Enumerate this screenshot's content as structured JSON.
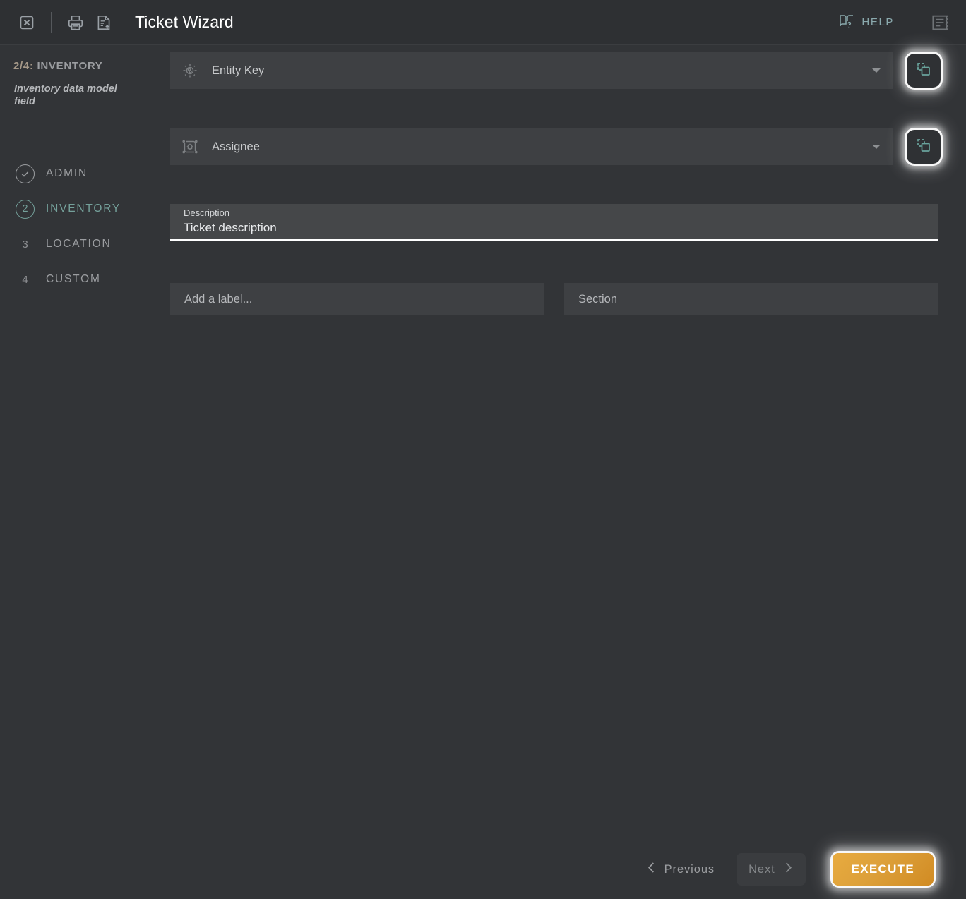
{
  "header": {
    "title": "Ticket Wizard",
    "close_icon": "close-box-icon",
    "print_icon": "printer-icon",
    "export_icon": "document-upload-icon",
    "help_label": "HELP",
    "help_icon": "book-question-icon",
    "log_icon": "log-receipt-icon"
  },
  "sidebar": {
    "step_fraction": "2/4:",
    "step_name": "INVENTORY",
    "step_description": "Inventory data model field",
    "steps": [
      {
        "marker": "✓",
        "label": "ADMIN",
        "state": "complete"
      },
      {
        "marker": "2",
        "label": "INVENTORY",
        "state": "active"
      },
      {
        "marker": "3",
        "label": "LOCATION",
        "state": "pending"
      },
      {
        "marker": "4",
        "label": "CUSTOM",
        "state": "pending"
      }
    ]
  },
  "main": {
    "entity_key": {
      "label": "Entity Key",
      "icon": "target-gear-icon",
      "copy_icon": "copy-duplicate-icon"
    },
    "assignee": {
      "label": "Assignee",
      "icon": "chip-gear-icon",
      "copy_icon": "copy-duplicate-icon"
    },
    "description": {
      "label": "Description",
      "value": "Ticket description"
    },
    "label_input": {
      "placeholder": "Add a label..."
    },
    "section_input": {
      "placeholder": "Section"
    }
  },
  "footer": {
    "previous_label": "Previous",
    "next_label": "Next",
    "execute_label": "EXECUTE",
    "prev_icon": "chevron-left-icon",
    "next_icon": "chevron-right-icon"
  },
  "colors": {
    "accent_teal": "#74a09a",
    "accent_amber": "#dda03a",
    "header_bg": "#2e3033",
    "body_bg": "#323437",
    "field_bg": "#3e4043"
  }
}
